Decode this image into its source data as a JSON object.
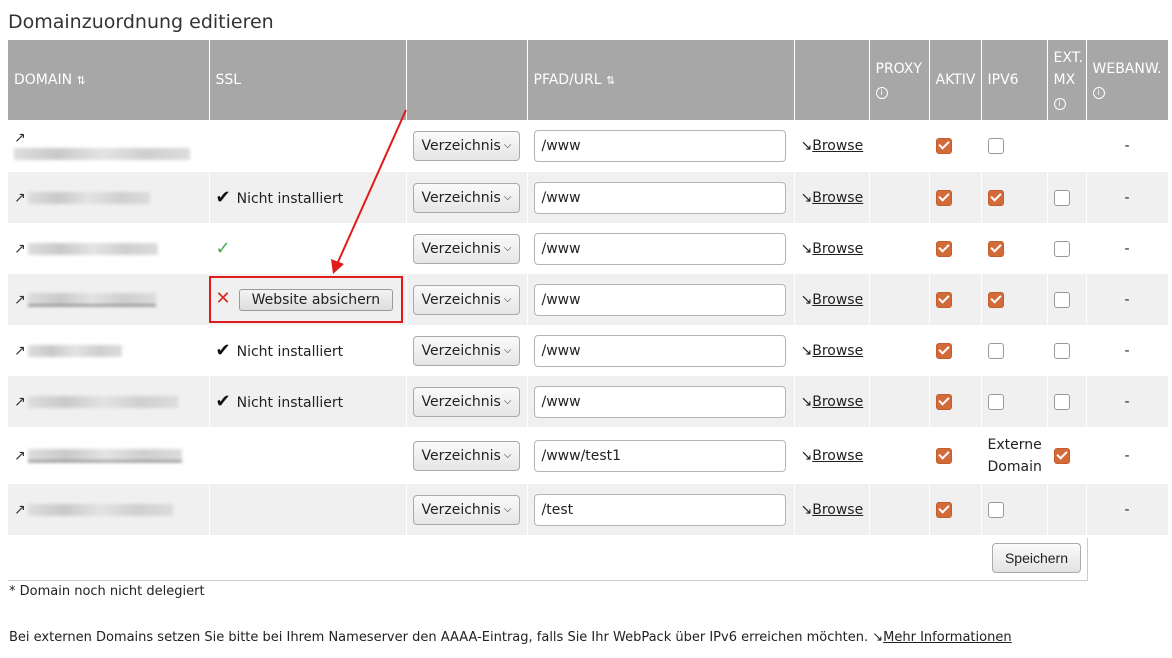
{
  "page": {
    "title": "Domainzuordnung editieren"
  },
  "columns": {
    "domain": "DOMAIN",
    "ssl": "SSL",
    "path": "PFAD/URL",
    "proxy": "PROXY",
    "aktiv": "AKTIV",
    "ipv6": "IPV6",
    "extmx_1": "EXT.",
    "extmx_2": "MX",
    "webanw": "WEBANW.",
    "sort_icon": "sort-icon",
    "info_icon": "info-icon"
  },
  "rows": [
    {
      "ssl_text": "",
      "select": "Verzeichnis",
      "path": "/www",
      "browse": "Browse",
      "aktiv": true,
      "ipv6": false,
      "extmx": null,
      "webanw": "-"
    },
    {
      "ssl_text": "Nicht installiert",
      "select": "Verzeichnis",
      "path": "/www",
      "browse": "Browse",
      "aktiv": true,
      "ipv6": true,
      "extmx": false,
      "webanw": "-"
    },
    {
      "ssl_text": "",
      "select": "Verzeichnis",
      "path": "/www",
      "browse": "Browse",
      "aktiv": true,
      "ipv6": true,
      "extmx": false,
      "webanw": "-"
    },
    {
      "ssl_button": "Website absichern",
      "select": "Verzeichnis",
      "path": "/www",
      "browse": "Browse",
      "aktiv": true,
      "ipv6": true,
      "extmx": false,
      "webanw": "-"
    },
    {
      "ssl_text": "Nicht installiert",
      "select": "Verzeichnis",
      "path": "/www",
      "browse": "Browse",
      "aktiv": true,
      "ipv6": false,
      "extmx": false,
      "webanw": "-"
    },
    {
      "ssl_text": "Nicht installiert",
      "select": "Verzeichnis",
      "path": "/www",
      "browse": "Browse",
      "aktiv": true,
      "ipv6": false,
      "extmx": false,
      "webanw": "-"
    },
    {
      "ssl_text": "",
      "select": "Verzeichnis",
      "path": "/www/test1",
      "browse": "Browse",
      "aktiv": true,
      "ipv6_text_1": "Externe",
      "ipv6_text_2": "Domain",
      "extmx": true,
      "webanw": "-"
    },
    {
      "ssl_text": "",
      "select": "Verzeichnis",
      "path": "/test",
      "browse": "Browse",
      "aktiv": true,
      "ipv6": false,
      "extmx": null,
      "webanw": "-"
    }
  ],
  "save_button": "Speichern",
  "notes": {
    "not_delegated": "* Domain noch nicht delegiert",
    "ipv6_hint": "Bei externen Domains setzen Sie bitte bei Ihrem Nameserver den AAAA-Eintrag, falls Sie Ihr WebPack über IPv6 erreichen möchten.",
    "more_info": "Mehr Informationen"
  },
  "colors": {
    "header_bg": "#a7a7a7",
    "checkbox_on": "#d26b39",
    "annotation_red": "#e01b1b",
    "ssl_ok_green": "#4aad52"
  }
}
